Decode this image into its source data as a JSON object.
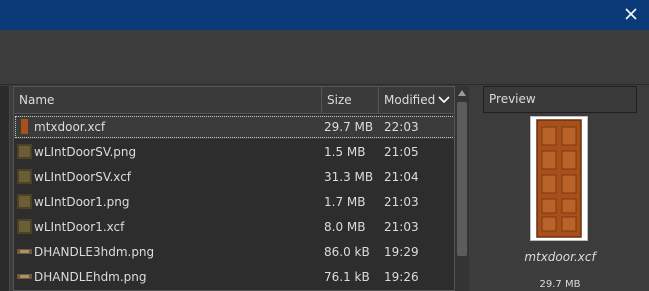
{
  "file_list": {
    "columns": {
      "name": "Name",
      "size": "Size",
      "modified": "Modified"
    },
    "sort_icon": "chevron-down-icon",
    "rows": [
      {
        "name": "mtxdoor.xcf",
        "size": "29.7 MB",
        "modified": "22:03",
        "selected": true
      },
      {
        "name": "wLIntDoorSV.png",
        "size": "1.5 MB",
        "modified": "21:05"
      },
      {
        "name": "wLIntDoorSV.xcf",
        "size": "31.3 MB",
        "modified": "21:04"
      },
      {
        "name": "wLIntDoor1.png",
        "size": "1.7 MB",
        "modified": "21:03"
      },
      {
        "name": "wLIntDoor1.xcf",
        "size": "8.0 MB",
        "modified": "21:03"
      },
      {
        "name": "DHANDLE3hdm.png",
        "size": "86.0 kB",
        "modified": "19:29"
      },
      {
        "name": "DHANDLEhdm.png",
        "size": "76.1 kB",
        "modified": "19:26"
      }
    ]
  },
  "preview": {
    "header": "Preview",
    "filename": "mtxdoor.xcf",
    "size": "29.7 MB"
  },
  "colors": {
    "titlebar": "#0b3a78",
    "door_wood": "#a8501a"
  }
}
